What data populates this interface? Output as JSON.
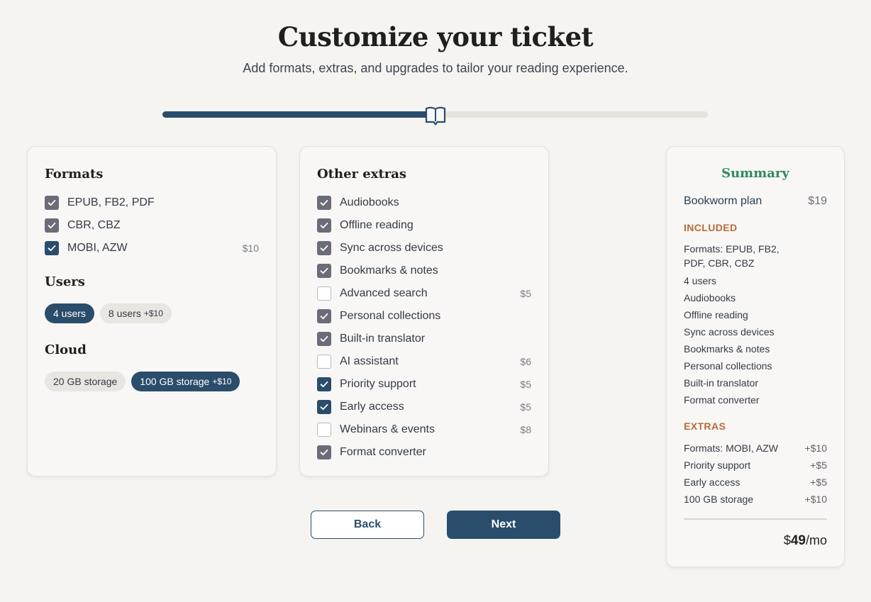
{
  "header": {
    "title": "Customize your ticket",
    "subtitle": "Add formats, extras, and upgrades to tailor your reading experience."
  },
  "progress": {
    "value": 0.5,
    "handle_icon": "book-icon"
  },
  "formats": {
    "title": "Formats",
    "items": [
      {
        "label": "EPUB, FB2, PDF",
        "price": "",
        "checked": true,
        "style": "included"
      },
      {
        "label": "CBR, CBZ",
        "price": "",
        "checked": true,
        "style": "included"
      },
      {
        "label": "MOBI, AZW",
        "price": "$10",
        "checked": true,
        "style": "paid"
      }
    ]
  },
  "users": {
    "title": "Users",
    "options": [
      {
        "label": "4 users",
        "plus": "",
        "selected": true
      },
      {
        "label": "8 users",
        "plus": "+$10",
        "selected": false
      }
    ]
  },
  "cloud": {
    "title": "Cloud",
    "options": [
      {
        "label": "20 GB storage",
        "plus": "",
        "selected": false
      },
      {
        "label": "100 GB storage",
        "plus": "+$10",
        "selected": true
      }
    ]
  },
  "extras": {
    "title": "Other extras",
    "items": [
      {
        "label": "Audiobooks",
        "price": "",
        "checked": true,
        "style": "included"
      },
      {
        "label": "Offline reading",
        "price": "",
        "checked": true,
        "style": "included"
      },
      {
        "label": "Sync across devices",
        "price": "",
        "checked": true,
        "style": "included"
      },
      {
        "label": "Bookmarks & notes",
        "price": "",
        "checked": true,
        "style": "included"
      },
      {
        "label": "Advanced search",
        "price": "$5",
        "checked": false,
        "style": "paid"
      },
      {
        "label": "Personal collections",
        "price": "",
        "checked": true,
        "style": "included"
      },
      {
        "label": "Built-in translator",
        "price": "",
        "checked": true,
        "style": "included"
      },
      {
        "label": "AI assistant",
        "price": "$6",
        "checked": false,
        "style": "paid"
      },
      {
        "label": "Priority support",
        "price": "$5",
        "checked": true,
        "style": "paid"
      },
      {
        "label": "Early access",
        "price": "$5",
        "checked": true,
        "style": "paid"
      },
      {
        "label": "Webinars & events",
        "price": "$8",
        "checked": false,
        "style": "paid"
      },
      {
        "label": "Format converter",
        "price": "",
        "checked": true,
        "style": "included"
      }
    ]
  },
  "summary": {
    "heading": "Summary",
    "plan_name": "Bookworm plan",
    "plan_price": "$19",
    "included_label": "INCLUDED",
    "included": [
      "Formats: EPUB, FB2, PDF, CBR, CBZ",
      "4 users",
      "Audiobooks",
      "Offline reading",
      "Sync across devices",
      "Bookmarks & notes",
      "Personal collections",
      "Built-in translator",
      "Format converter"
    ],
    "extras_label": "EXTRAS",
    "extras": [
      {
        "label": "Formats: MOBI, AZW",
        "amount": "+$10"
      },
      {
        "label": "Priority support",
        "amount": "+$5"
      },
      {
        "label": "Early access",
        "amount": "+$5"
      },
      {
        "label": "100 GB storage",
        "amount": "+$10"
      }
    ],
    "total_symbol": "$",
    "total_value": "49",
    "total_period": "/mo"
  },
  "buttons": {
    "back": "Back",
    "next": "Next"
  },
  "colors": {
    "accent": "#2a4d6b",
    "summary_heading": "#2f8a5c",
    "section_label": "#b86a3c",
    "checkbox_included": "#6b6c78"
  }
}
